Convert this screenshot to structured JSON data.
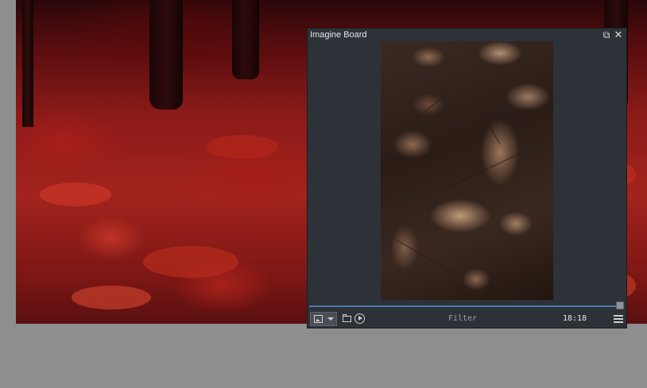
{
  "window": {
    "title": "Imagine Board"
  },
  "toolbar": {
    "filter_placeholder": "Filter",
    "time": "18:18"
  },
  "progress": {
    "value_fraction": 1.0
  },
  "colors": {
    "window_bg": "#2d3138",
    "progress_accent": "#4b7ba8",
    "workspace_bg": "#8e8e8e"
  },
  "icons": [
    "restore-icon",
    "close-icon",
    "picture-icon",
    "chevron-down-icon",
    "folder-icon",
    "play-icon",
    "hamburger-menu-icon"
  ]
}
